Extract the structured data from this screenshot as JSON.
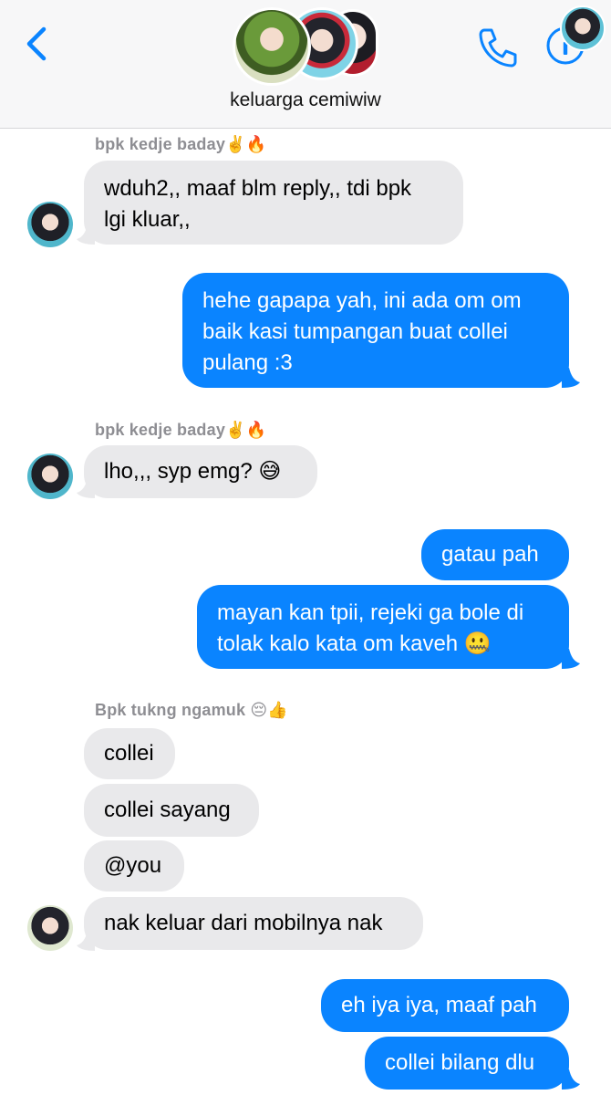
{
  "header": {
    "group_name": "keluarga cemiwiw",
    "back_icon": "chevron-left-icon",
    "call_icon": "phone-icon",
    "info_icon": "info-icon",
    "accent_color": "#0a84ff"
  },
  "messages": [
    {
      "sender": "bpk kedje baday✌️🔥",
      "text": "wduh2,, maaf blm reply,, tdi bpk\nlgi kluar,,",
      "direction": "in"
    },
    {
      "text": "hehe gapapa yah, ini ada om om\nbaik kasi tumpangan buat collei\npulang :3",
      "direction": "out"
    },
    {
      "sender": "bpk kedje baday✌️🔥",
      "text": "lho,,, syp emg? 😅",
      "direction": "in"
    },
    {
      "text": "gatau pah",
      "direction": "out"
    },
    {
      "text": "mayan kan tpii, rejeki ga bole di\ntolak kalo kata om kaveh 🤐",
      "direction": "out"
    },
    {
      "sender": "Bpk tukng ngamuk 😔👍",
      "text": "collei",
      "direction": "in"
    },
    {
      "text": "collei sayang",
      "direction": "in"
    },
    {
      "text": "@you",
      "direction": "in"
    },
    {
      "text": "nak keluar dari mobilnya nak",
      "direction": "in"
    },
    {
      "text": "eh iya iya, maaf pah",
      "direction": "out"
    },
    {
      "text": "collei bilang dlu",
      "direction": "out"
    }
  ]
}
